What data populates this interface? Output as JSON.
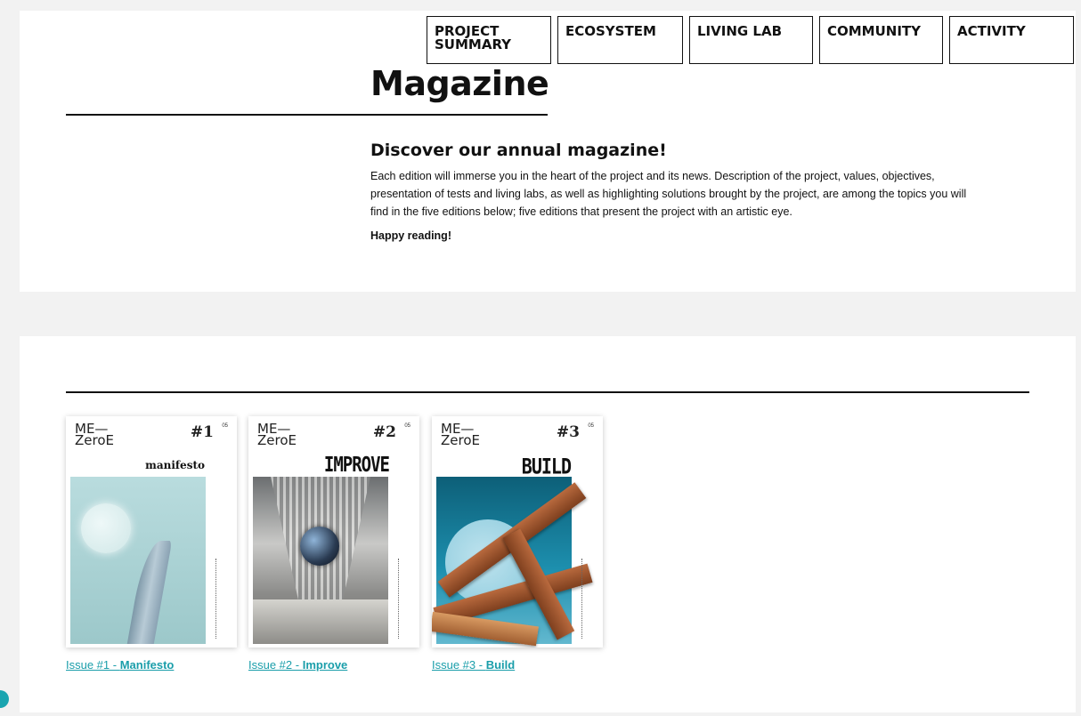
{
  "nav": {
    "items": [
      {
        "label": "PROJECT SUMMARY"
      },
      {
        "label": "ECOSYSTEM"
      },
      {
        "label": "LIVING LAB"
      },
      {
        "label": "COMMUNITY"
      },
      {
        "label": "ACTIVITY"
      }
    ]
  },
  "header": {
    "title": "Magazine"
  },
  "intro": {
    "subtitle": "Discover our annual magazine!",
    "description": "Each edition will immerse you in the heart of the project and its news. Description of the project, values, objectives, presentation of tests and living labs, as well as highlighting solutions brought by the project, are among the topics you will find in the five editions below; five editions that present the project with an artistic eye.",
    "closing": "Happy reading!"
  },
  "issues": [
    {
      "brand_line1": "ME—",
      "brand_line2": "ZeroE",
      "number": "1",
      "total": "05",
      "cover_title": "manifesto",
      "link_prefix": "Issue #1 - ",
      "link_name": "Manifesto"
    },
    {
      "brand_line1": "ME—",
      "brand_line2": "ZeroE",
      "number": "2",
      "total": "05",
      "cover_title": "IMPROVE",
      "link_prefix": "Issue #2 - ",
      "link_name": "Improve"
    },
    {
      "brand_line1": "ME—",
      "brand_line2": "ZeroE",
      "number": "3",
      "total": "05",
      "cover_title": "BUILD",
      "link_prefix": "Issue #3 - ",
      "link_name": "Build"
    }
  ],
  "colors": {
    "link": "#1a9eaa",
    "background": "#f2f2f2",
    "panel": "#ffffff"
  }
}
